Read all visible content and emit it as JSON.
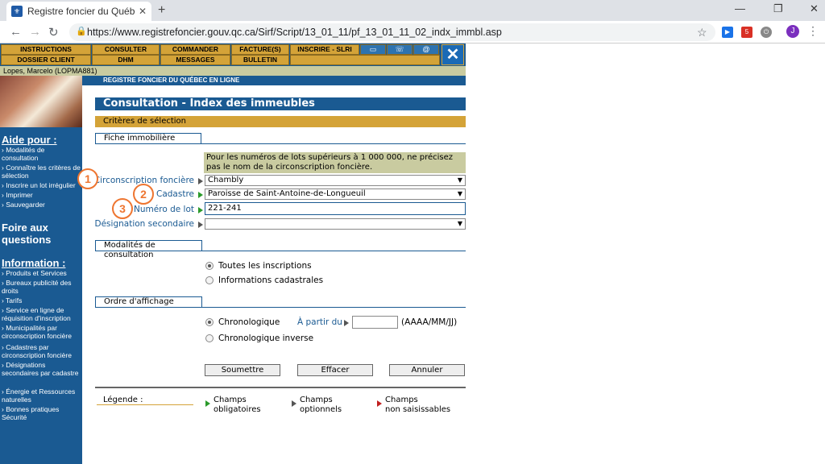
{
  "browser": {
    "tab_title": "Registre foncier du Québec en ligne",
    "url": "https://www.registrefoncier.gouv.qc.ca/Sirf/Script/13_01_11/pf_13_01_11_02_indx_immbl.asp",
    "avatar_letter": "J",
    "ext_badge": "5"
  },
  "menu": {
    "row1": [
      "INSTRUCTIONS",
      "CONSULTER",
      "COMMANDER",
      "FACTURE(S)",
      "INSCRIRE - SLRI"
    ],
    "row2": [
      "DOSSIER CLIENT",
      "DHM",
      "MESSAGES",
      "BULLETIN"
    ]
  },
  "user": "Lopes, Marcelo (LOPMA881)",
  "banner": "REGISTRE FONCIER DU QUÉBEC EN LIGNE",
  "sidebar": {
    "aide_title": "Aide pour :",
    "aide_items": [
      "Modalités de consultation",
      "Connaître les critères de sélection",
      "Inscrire un lot irrégulier",
      "Imprimer",
      "Sauvegarder"
    ],
    "foire_title": "Foire aux questions",
    "info_title": "Information :",
    "info_items": [
      "Produits et Services",
      "Bureaux publicité des droits",
      "Tarifs",
      "Service en ligne de réquisition d'inscription",
      "Municipalités par circonscription foncière",
      "Cadastres par circonscription foncière",
      "Désignations secondaires par cadastre",
      "Énergie et Ressources naturelles",
      "Bonnes pratiques Sécurité"
    ]
  },
  "page": {
    "title": "Consultation - Index des immeubles",
    "criteria": "Critères de sélection",
    "fiche_section": "Fiche immobilière",
    "note": "Pour les numéros de lots supérieurs à 1 000 000, ne précisez pas le nom de la circonscription foncière.",
    "fields": {
      "circonscription": {
        "label": "Circonscription foncière",
        "value": "Chambly"
      },
      "cadastre": {
        "label": "Cadastre",
        "value": "Paroisse de Saint-Antoine-de-Longueuil"
      },
      "numero_lot": {
        "label": "Numéro de lot",
        "value": "221-241"
      },
      "designation": {
        "label": "Désignation secondaire",
        "value": ""
      }
    },
    "callouts": [
      "1",
      "2",
      "3"
    ],
    "modalites_section": "Modalités de consultation",
    "modalites_options": [
      "Toutes les inscriptions",
      "Informations cadastrales"
    ],
    "ordre_section": "Ordre d'affichage",
    "ordre_options": [
      "Chronologique",
      "Chronologique inverse"
    ],
    "a_partir_label": "À partir du",
    "date_value": "",
    "date_format": "(AAAA/MM/JJ)",
    "buttons": {
      "submit": "Soumettre",
      "clear": "Effacer",
      "cancel": "Annuler"
    },
    "legend_title": "Légende :",
    "legend": [
      {
        "line1": "Champs",
        "line2": "obligatoires"
      },
      {
        "line1": "Champs",
        "line2": "optionnels"
      },
      {
        "line1": "Champs",
        "line2": "non saisissables"
      }
    ]
  },
  "colors": {
    "navy": "#1a5a92",
    "gold": "#d4a338",
    "callout": "#ee7530"
  }
}
